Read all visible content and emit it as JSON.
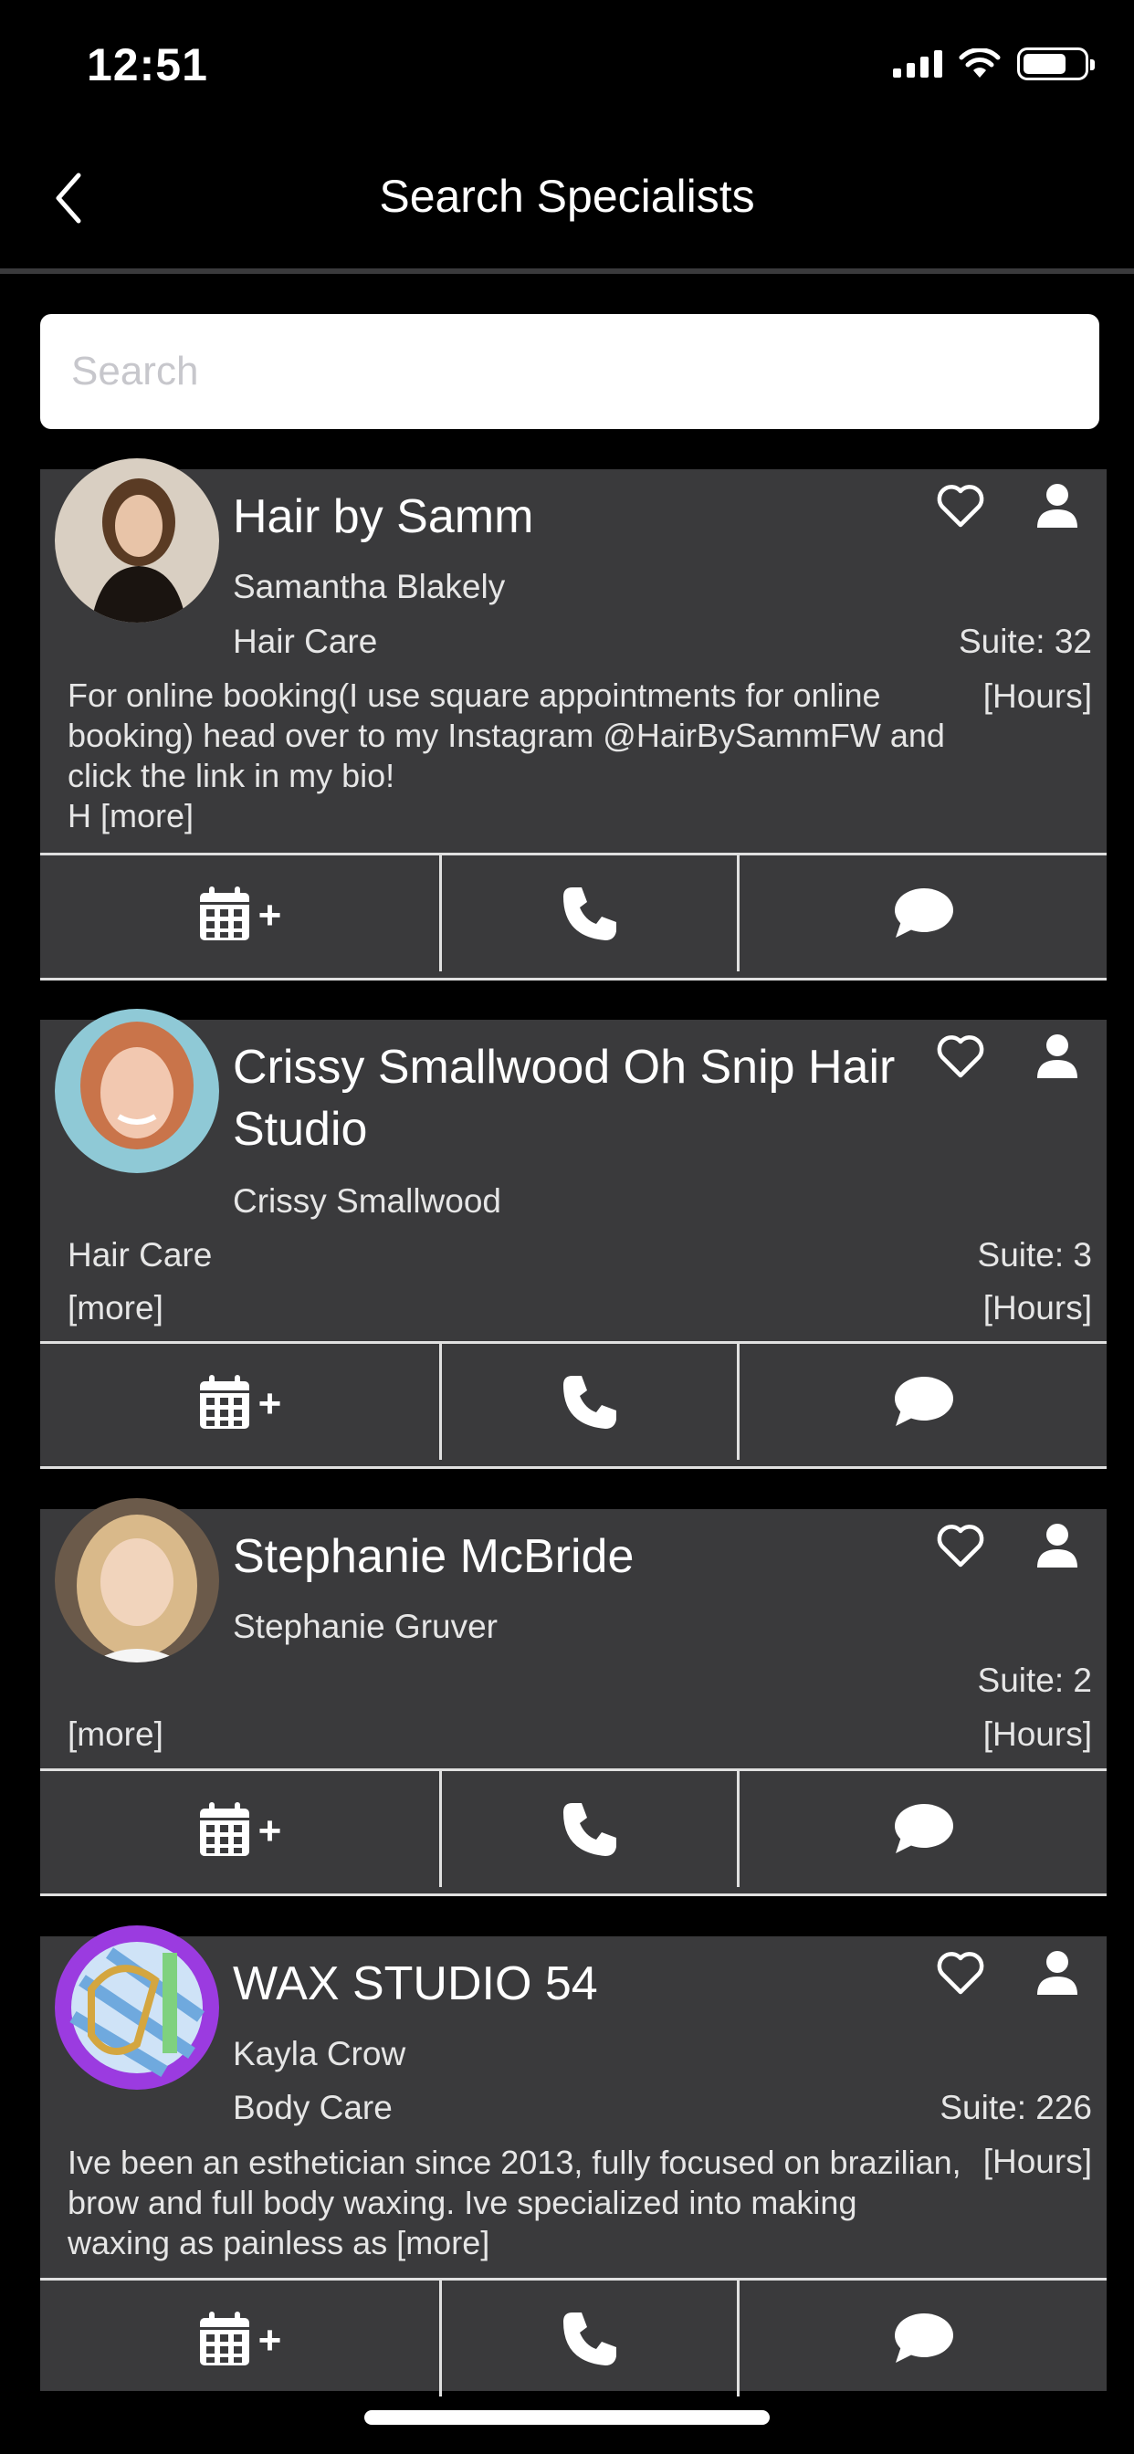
{
  "status_bar": {
    "time": "12:51"
  },
  "nav": {
    "title": "Search Specialists"
  },
  "search": {
    "placeholder": "Search"
  },
  "specialists": [
    {
      "business": "Hair by Samm",
      "owner": "Samantha Blakely",
      "category": "Hair Care",
      "suite": "Suite: 32",
      "hours": "[Hours]",
      "description": "For online booking(I use square appointments for online booking) head over to my Instagram @HairBySammFW and click the link in my bio!\nH [more]",
      "avatar_colors": [
        "#d9cfc2",
        "#1a1410"
      ]
    },
    {
      "business": "Crissy Smallwood Oh Snip Hair Studio",
      "owner": "Crissy Smallwood",
      "category": "Hair Care",
      "suite": "Suite: 3",
      "more": "[more]",
      "hours": "[Hours]",
      "avatar_colors": [
        "#8fc9d6",
        "#c9744a"
      ]
    },
    {
      "business": "Stephanie McBride",
      "owner": "Stephanie Gruver",
      "suite": "Suite: 2",
      "more": "[more]",
      "hours": "[Hours]",
      "avatar_colors": [
        "#6b5a4a",
        "#d9b98a"
      ]
    },
    {
      "business": "WAX STUDIO 54",
      "owner": "Kayla Crow",
      "category": "Body Care",
      "suite": "Suite: 226",
      "hours": "[Hours]",
      "description": "Ive been an esthetician since 2013, fully focused on brazilian, brow and full body waxing. Ive specialized into making waxing as painless as [more]",
      "avatar_colors": [
        "#9b3be0",
        "#cfe3f7"
      ]
    }
  ],
  "actions": {
    "add_label": "+"
  },
  "icons": {
    "back": "chevron-left-icon",
    "favorite": "heart-outline-icon",
    "profile": "person-icon",
    "book": "calendar-icon",
    "call": "phone-icon",
    "message": "chat-bubble-icon"
  }
}
